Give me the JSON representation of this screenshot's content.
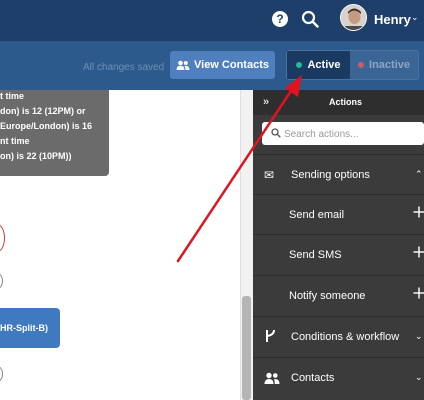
{
  "header": {
    "user_name": "Henry"
  },
  "toolbar": {
    "saved_status": "All changes saved",
    "view_contacts_label": "View Contacts",
    "status_active_label": "Active",
    "status_inactive_label": "Inactive",
    "active_dot_color": "#25b89a",
    "inactive_dot_color": "#c95b6b"
  },
  "canvas": {
    "tooltip_lines": [
      "t time",
      "don) is 12 (12PM) or",
      "Europe/London) is 16",
      "nt time",
      "on) is 22 (10PM))"
    ],
    "node_label": "HR-Split-B)"
  },
  "actions_panel": {
    "collapse_label": "»",
    "title": "Actions",
    "search_placeholder": "Search actions...",
    "groups": [
      {
        "label": "Sending options",
        "icon": "envelope-icon",
        "caret": "^"
      },
      {
        "label": "Conditions & workflow",
        "icon": "fork-icon",
        "caret": "v"
      },
      {
        "label": "Contacts",
        "icon": "users-icon",
        "caret": "v"
      }
    ],
    "sending_items": [
      {
        "label": "Send email"
      },
      {
        "label": "Send SMS"
      },
      {
        "label": "Notify someone"
      }
    ]
  }
}
